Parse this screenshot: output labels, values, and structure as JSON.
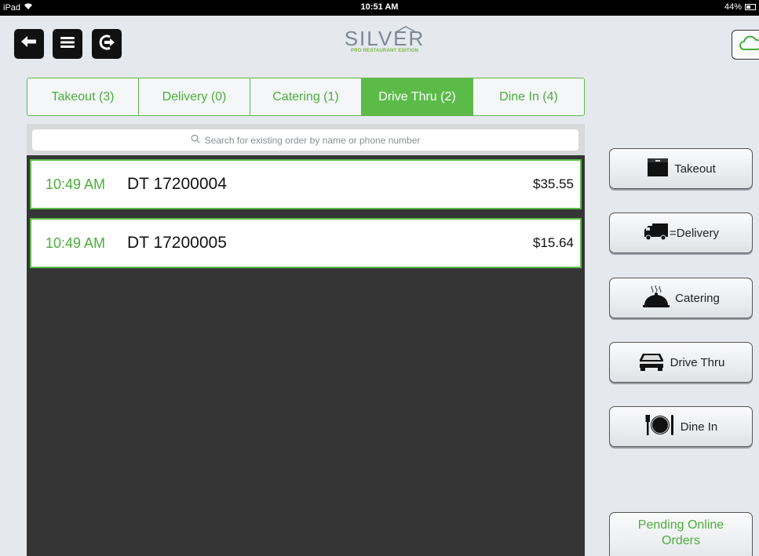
{
  "status_bar": {
    "device": "iPad",
    "time": "10:51 AM",
    "battery": "44%"
  },
  "header": {
    "logo_title": "SILVER",
    "logo_subtitle": "PRO RESTAURANT EDITION"
  },
  "tabs": [
    {
      "label": "Takeout (3)",
      "active": false
    },
    {
      "label": "Delivery (0)",
      "active": false
    },
    {
      "label": "Catering (1)",
      "active": false
    },
    {
      "label": "Drive Thru (2)",
      "active": true
    },
    {
      "label": "Dine In (4)",
      "active": false
    }
  ],
  "search": {
    "placeholder": "Search for existing order by name or phone number"
  },
  "orders": [
    {
      "time": "10:49 AM",
      "id": "DT 17200004",
      "amount": "$35.55"
    },
    {
      "time": "10:49 AM",
      "id": "DT 17200005",
      "amount": "$15.64"
    }
  ],
  "side_buttons": [
    {
      "label": "Takeout",
      "icon": "takeout-box-icon"
    },
    {
      "label": "=Delivery",
      "icon": "delivery-truck-icon"
    },
    {
      "label": "Catering",
      "icon": "catering-cloche-icon"
    },
    {
      "label": "Drive Thru",
      "icon": "car-icon"
    },
    {
      "label": "Dine In",
      "icon": "plate-cutlery-icon"
    }
  ],
  "pending": {
    "label": "Pending Online Orders"
  },
  "colors": {
    "accent_green": "#5cbb48",
    "panel_dark": "#353535",
    "background": "#e5e9ee"
  }
}
